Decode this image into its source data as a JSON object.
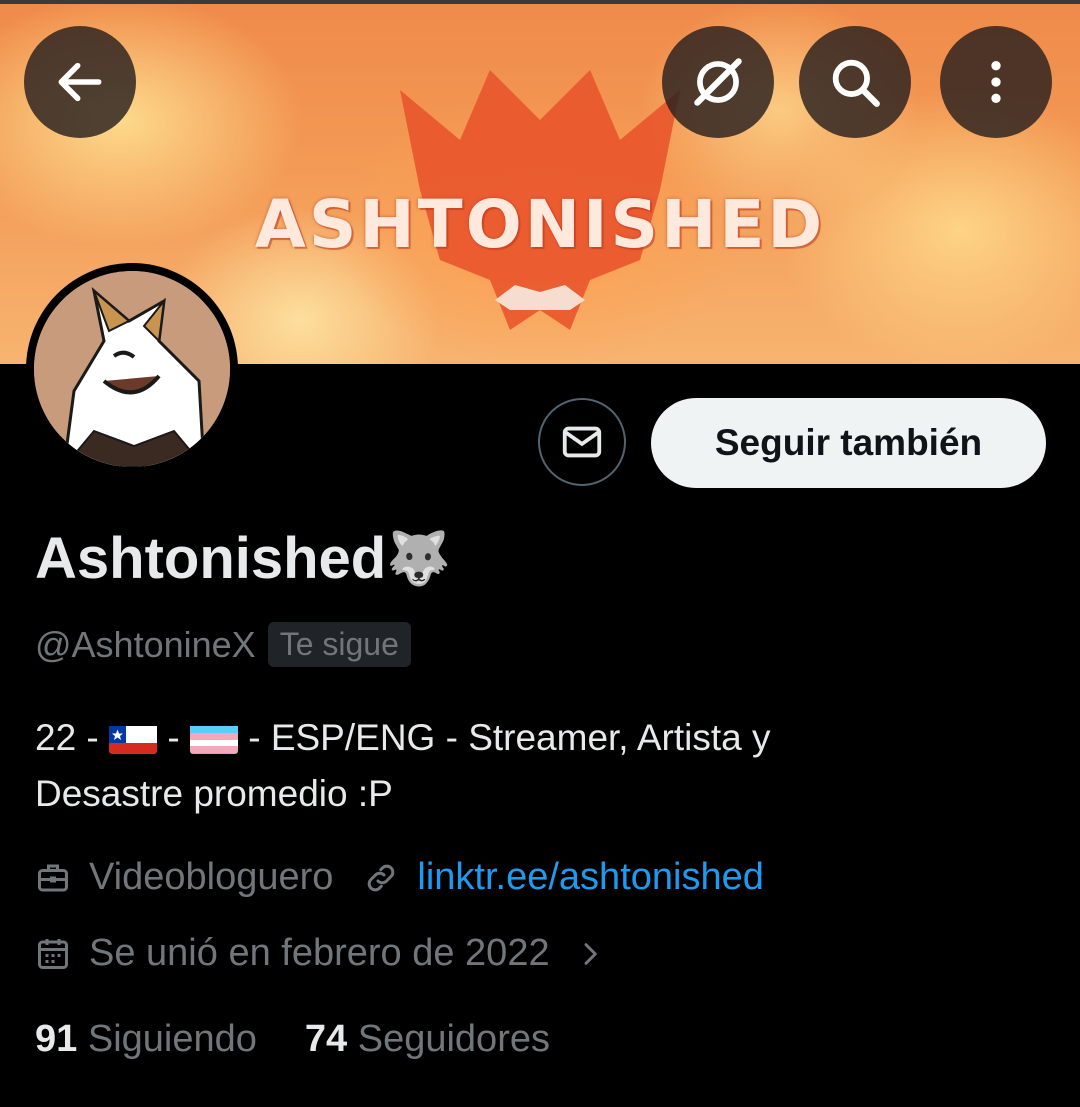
{
  "banner": {
    "title": "ASHTONISHED",
    "colors": {
      "base": "#f39a55",
      "emblem": "#e8512a"
    }
  },
  "header_buttons": {
    "back": "arrow-left-icon",
    "grok": "no-signal-icon",
    "search": "search-icon",
    "more": "more-vertical-icon"
  },
  "profile": {
    "display_name": "Ashtonished",
    "name_emoji": "🐺",
    "handle": "@AshtonineX",
    "follows_you": "Te sigue",
    "bio": {
      "part1": "22 - ",
      "sep1": " - ",
      "sep2": " - ESP/ENG - Streamer, Artista y",
      "line2": "Desastre promedio :P"
    },
    "profession": "Videobloguero",
    "link": "linktr.ee/ashtonished",
    "joined": "Se unió en febrero de 2022",
    "following_count": "91",
    "following_label": "Siguiendo",
    "followers_count": "74",
    "followers_label": "Seguidores"
  },
  "actions": {
    "follow_back": "Seguir también",
    "message": "envelope-icon"
  },
  "colors": {
    "background": "#000000",
    "text": "#e7e9ea",
    "muted": "#71767b",
    "link": "#1d9bf0",
    "button_bg": "#eff3f4"
  }
}
